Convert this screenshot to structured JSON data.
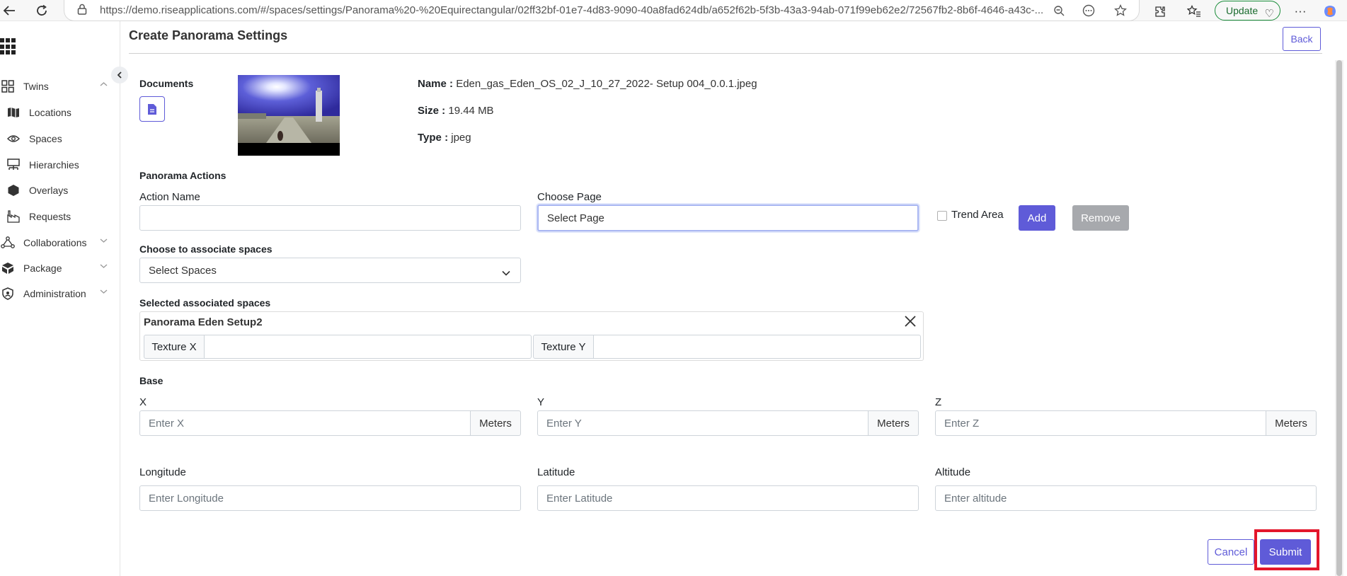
{
  "browser": {
    "url": "https://demo.riseapplications.com/#/spaces/settings/Panorama%20-%20Equirectangular/02ff32bf-01e7-4d83-9090-40a8fad624db/a652f62b-5f3b-43a3-94ab-071f99eb62e2/72567fb2-8b6f-4646-a43c-...",
    "update_label": "Update"
  },
  "sidebar": {
    "items": [
      {
        "label": "Twins",
        "icon": "grid-icon",
        "expandable": true
      },
      {
        "label": "Locations",
        "icon": "map-icon"
      },
      {
        "label": "Spaces",
        "icon": "eye-icon"
      },
      {
        "label": "Hierarchies",
        "icon": "hierarchy-icon"
      },
      {
        "label": "Overlays",
        "icon": "cube-icon"
      },
      {
        "label": "Requests",
        "icon": "factory-icon"
      },
      {
        "label": "Collaborations",
        "icon": "network-icon",
        "expandable": true
      },
      {
        "label": "Package",
        "icon": "box-icon",
        "expandable": true
      },
      {
        "label": "Administration",
        "icon": "shield-icon",
        "expandable": true
      }
    ]
  },
  "page": {
    "title": "Create Panorama Settings",
    "back_label": "Back"
  },
  "documents": {
    "label": "Documents",
    "name_label": "Name :",
    "name_value": "Eden_gas_Eden_OS_02_J_10_27_2022- Setup 004_0.0.1.jpeg",
    "size_label": "Size :",
    "size_value": "19.44 MB",
    "type_label": "Type :",
    "type_value": "jpeg"
  },
  "actions": {
    "section_label": "Panorama Actions",
    "action_name_label": "Action Name",
    "action_name_value": "",
    "choose_page_label": "Choose Page",
    "choose_page_value": "Select Page",
    "trend_area_label": "Trend Area",
    "trend_area_checked": false,
    "add_label": "Add",
    "remove_label": "Remove"
  },
  "spaces": {
    "choose_label": "Choose to associate spaces",
    "select_value": "Select Spaces",
    "selected_label": "Selected associated spaces",
    "selected": [
      {
        "name": "Panorama Eden Setup2",
        "texture_x_label": "Texture X",
        "texture_x_value": "",
        "texture_y_label": "Texture Y",
        "texture_y_value": ""
      }
    ]
  },
  "base": {
    "section_label": "Base",
    "x_label": "X",
    "x_placeholder": "Enter X",
    "y_label": "Y",
    "y_placeholder": "Enter Y",
    "z_label": "Z",
    "z_placeholder": "Enter Z",
    "unit": "Meters",
    "longitude_label": "Longitude",
    "longitude_placeholder": "Enter Longitude",
    "latitude_label": "Latitude",
    "latitude_placeholder": "Enter Latitude",
    "altitude_label": "Altitude",
    "altitude_placeholder": "Enter altitude"
  },
  "footer": {
    "cancel_label": "Cancel",
    "submit_label": "Submit"
  },
  "colors": {
    "primary": "#5f5bd8",
    "secondary": "#a7a9ad",
    "highlight": "#e3162b"
  }
}
